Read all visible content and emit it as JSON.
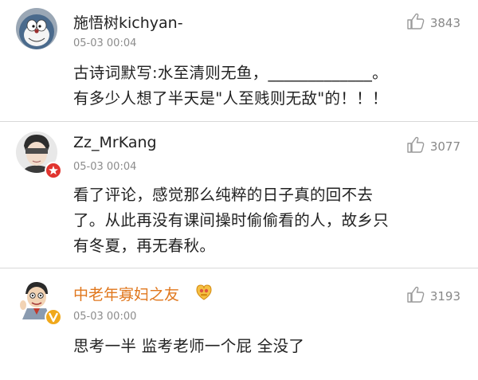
{
  "comments": [
    {
      "username": "施悟树kichyan-",
      "time": "05-03 00:04",
      "likes": "3843",
      "avatar_icon": "doraemon-avatar-icon",
      "text_lines": [
        "古诗词默写:水至清则无鱼，_____________。",
        "有多少人想了半天是\"人至贱则无敌\"的！！！"
      ]
    },
    {
      "username": "Zz_MrKang",
      "time": "05-03 00:04",
      "likes": "3077",
      "avatar_icon": "blindfolded-person-avatar-icon",
      "badge_icon": "red-star-badge-icon",
      "text_lines": [
        "看了评论，感觉那么纯粹的日子真的回不去",
        "了。从此再没有课间操时偷偷看的人，故乡只",
        "有冬夏，再无春秋。"
      ]
    },
    {
      "username": "中老年寡妇之友",
      "time": "05-03 00:00",
      "likes": "3193",
      "avatar_icon": "cartoon-man-avatar-icon",
      "badge_icon": "verified-v-badge-icon",
      "medal_icon": "fan-medal-icon",
      "text_lines": [
        "思考一半 监考老师一个屁 全没了"
      ]
    }
  ],
  "colors": {
    "vip_name": "#e0771d",
    "verified_badge": "#f0a81b",
    "star_badge": "#e1342f"
  }
}
